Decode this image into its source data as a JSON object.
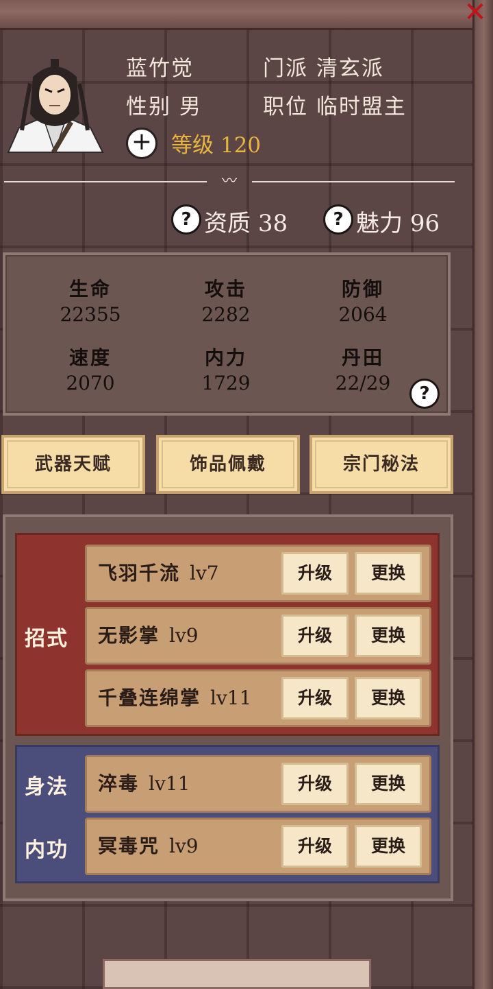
{
  "header": {
    "name": "蓝竹觉",
    "sect_label": "门派",
    "sect": "清玄派",
    "gender_label": "性别",
    "gender": "男",
    "position_label": "职位",
    "position": "临时盟主",
    "level_label": "等级",
    "level": "120"
  },
  "traits": {
    "aptitude_label": "资质",
    "aptitude": "38",
    "charm_label": "魅力",
    "charm": "96"
  },
  "stats": [
    {
      "label": "生命",
      "value": "22355"
    },
    {
      "label": "攻击",
      "value": "2282"
    },
    {
      "label": "防御",
      "value": "2064"
    },
    {
      "label": "速度",
      "value": "2070"
    },
    {
      "label": "内力",
      "value": "1729"
    },
    {
      "label": "丹田",
      "value": "22/29"
    }
  ],
  "tabs": [
    "武器天赋",
    "饰品佩戴",
    "宗门秘法"
  ],
  "groups": {
    "moves": "招式",
    "movement": "身法",
    "inner": "内功"
  },
  "skills": [
    {
      "name": "飞羽千流",
      "level": "lv7"
    },
    {
      "name": "无影掌",
      "level": "lv9"
    },
    {
      "name": "千叠连绵掌",
      "level": "lv11"
    },
    {
      "name": "淬毒",
      "level": "lv11"
    },
    {
      "name": "冥毒咒",
      "level": "lv9"
    }
  ],
  "buttons": {
    "upgrade": "升级",
    "replace": "更换"
  },
  "icons": {
    "close": "close-icon",
    "add": "plus-icon",
    "help": "question-icon"
  },
  "colors": {
    "moves_group": "#8e332d",
    "inner_group": "#4b4d7a",
    "level_text": "#e8b640",
    "close": "#c0141a"
  }
}
